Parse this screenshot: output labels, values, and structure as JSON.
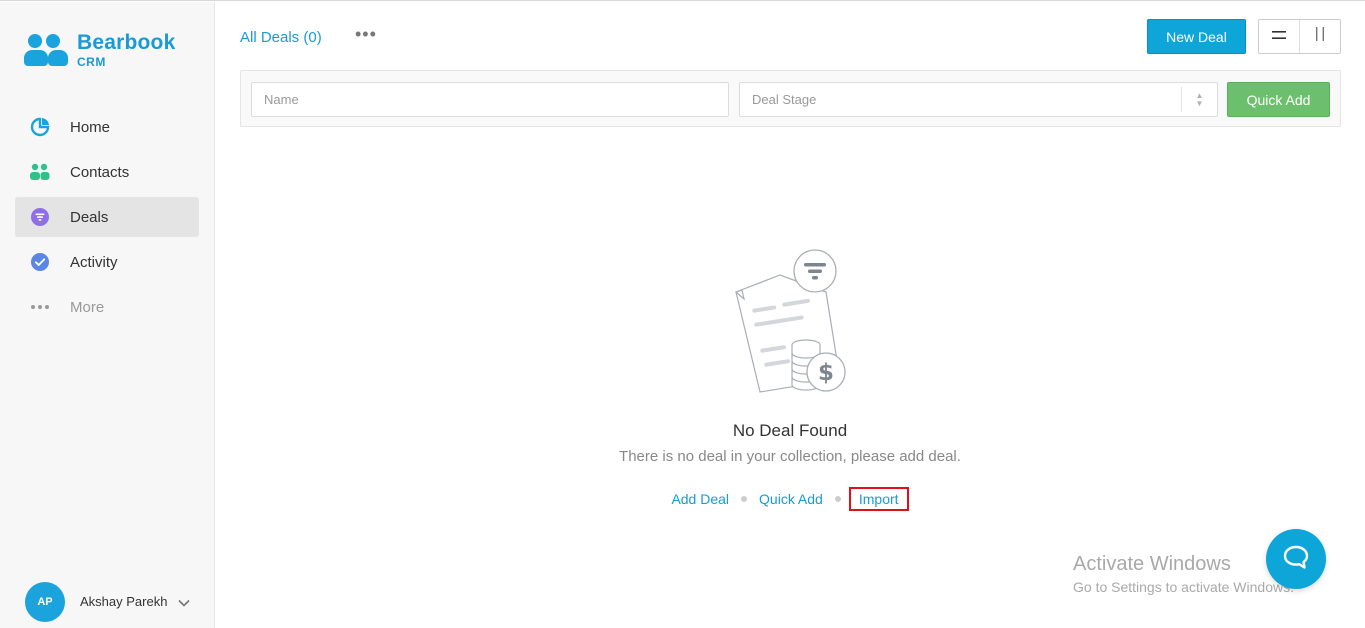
{
  "brand": {
    "name": "Bearbook",
    "sub": "CRM",
    "color": "#1a9ad6"
  },
  "sidebar": {
    "items": [
      {
        "label": "Home",
        "icon": "pie-chart-icon",
        "color": "#1aa3dc",
        "active": false
      },
      {
        "label": "Contacts",
        "icon": "contacts-icon",
        "color": "#2ec28a",
        "active": false
      },
      {
        "label": "Deals",
        "icon": "funnel-icon",
        "color": "#8f6ee8",
        "active": true
      },
      {
        "label": "Activity",
        "icon": "check-circle-icon",
        "color": "#5b86e5",
        "active": false
      },
      {
        "label": "More",
        "icon": "ellipsis-icon",
        "color": "#999999",
        "active": false
      }
    ]
  },
  "user": {
    "initials": "AP",
    "name": "Akshay Parekh"
  },
  "header": {
    "title": "All Deals (0)",
    "more": "•••",
    "new_deal": "New Deal"
  },
  "filters": {
    "name_placeholder": "Name",
    "stage_placeholder": "Deal Stage",
    "quick_add": "Quick Add"
  },
  "empty": {
    "title": "No Deal Found",
    "desc": "There is no deal in your collection, please add deal.",
    "add_deal": "Add Deal",
    "quick_add": "Quick Add",
    "import": "Import"
  },
  "watermark": {
    "line1": "Activate Windows",
    "line2": "Go to Settings to activate Windows."
  },
  "colors": {
    "accent": "#0ea5d8",
    "success": "#6cbf6c",
    "highlight": "#e0101a"
  }
}
